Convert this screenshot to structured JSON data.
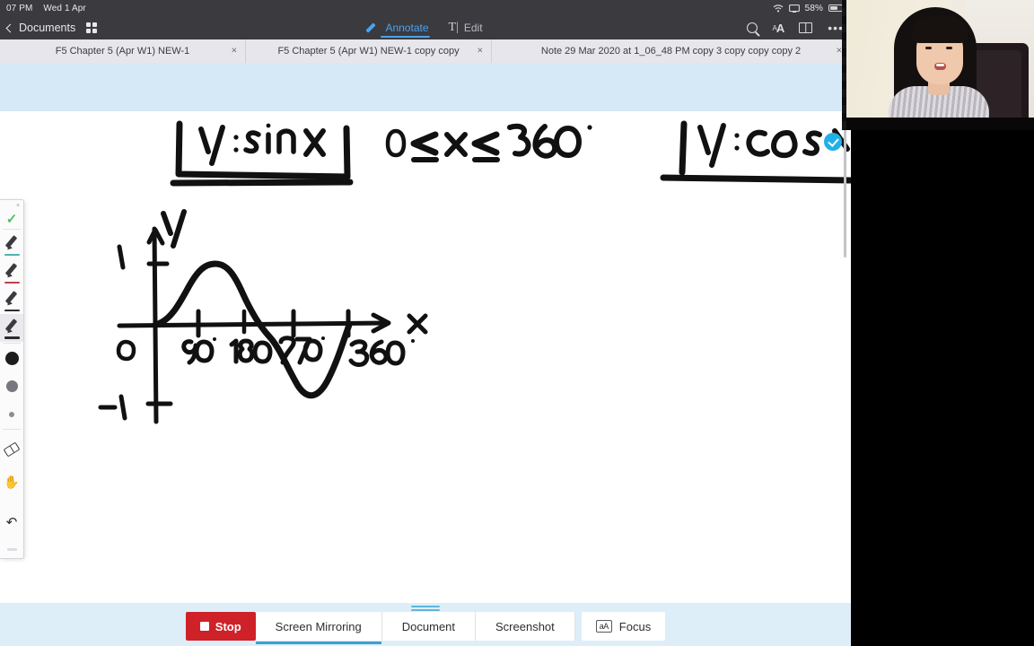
{
  "statusbar": {
    "clock": "07 PM",
    "date": "Wed 1 Apr",
    "battery_percent": "58%",
    "wifi_icon": "wifi-icon",
    "mirroring_icon": "screen-mirroring-icon",
    "battery_icon": "battery-icon"
  },
  "toolbar": {
    "back_label": "Documents",
    "grid_icon": "grid-view-icon",
    "modes": [
      {
        "label": "Annotate",
        "icon": "pen-icon",
        "active": true
      },
      {
        "label": "Edit",
        "icon": "text-cursor-icon",
        "active": false
      }
    ],
    "actions": [
      {
        "name": "search-icon",
        "label": ""
      },
      {
        "name": "text-size-icon",
        "label": "aA"
      },
      {
        "name": "reading-view-icon",
        "label": ""
      },
      {
        "name": "more-options-icon",
        "label": "•••"
      }
    ]
  },
  "tabs": [
    {
      "label": "F5 Chapter 5 (Apr W1) NEW-1",
      "close": "×",
      "active": false
    },
    {
      "label": "F5 Chapter 5 (Apr W1) NEW-1 copy copy",
      "close": "×",
      "active": false
    },
    {
      "label": "Note 29 Mar 2020 at 1_06_48 PM copy 3 copy copy copy 2",
      "close": "×",
      "active": true
    }
  ],
  "palette": {
    "close_label": "×",
    "tools": [
      {
        "name": "confirm-check-tool",
        "kind": "check",
        "color": "#49c45e"
      },
      {
        "name": "pen-tool-teal",
        "kind": "pen",
        "color": "#4fb3ac",
        "selected": false
      },
      {
        "name": "pen-tool-red",
        "kind": "pen",
        "color": "#c0414f",
        "selected": false
      },
      {
        "name": "pen-tool-black",
        "kind": "pen",
        "color": "#2c2c30",
        "selected": false
      },
      {
        "name": "highlighter-tool",
        "kind": "pen",
        "color": "#2c2c30",
        "selected": true
      },
      {
        "name": "stroke-size-large",
        "kind": "dot-lg",
        "color": "#1d1d1f"
      },
      {
        "name": "stroke-size-medium",
        "kind": "dot-md",
        "color": "#77777d"
      },
      {
        "name": "stroke-size-small",
        "kind": "dot-sm",
        "color": "#8d8d93"
      },
      {
        "name": "eraser-tool",
        "kind": "eraser",
        "color": "#3a3a3f"
      },
      {
        "name": "hand-pan-tool",
        "kind": "hand",
        "color": "#2c2c30"
      },
      {
        "name": "undo-button",
        "kind": "undo",
        "color": "#2c2c30"
      }
    ]
  },
  "page": {
    "handwriting": {
      "title_boxed": "y = sin x",
      "domain": "0 ≤ x ≤ 360°",
      "second_title": "y = cos x",
      "axis_y_label": "y",
      "axis_x_label": "x",
      "origin_label": "0",
      "y_max_label": "1",
      "y_min_label": "-1",
      "x_ticks": [
        "90°",
        "180°",
        "270°",
        "360°"
      ]
    },
    "status_badge_icon": "check-circle-icon"
  },
  "chart_data": {
    "type": "line",
    "title": "y = sin x",
    "subtitle": "0 ≤ x ≤ 360°",
    "xlabel": "x",
    "ylabel": "y",
    "xlim": [
      0,
      400
    ],
    "ylim": [
      -1,
      1
    ],
    "x_tick_labels": [
      "0",
      "90°",
      "180°",
      "270°",
      "360°"
    ],
    "x_ticks": [
      0,
      90,
      180,
      270,
      360
    ],
    "y_tick_labels": [
      "1",
      "-1"
    ],
    "y_ticks": [
      1,
      -1
    ],
    "grid": false,
    "legend": "none",
    "series": [
      {
        "name": "sin x",
        "x": [
          0,
          30,
          60,
          90,
          120,
          150,
          180,
          210,
          240,
          270,
          300,
          330,
          360
        ],
        "values": [
          0,
          0.5,
          0.87,
          1,
          0.87,
          0.5,
          0,
          -0.5,
          -0.87,
          -1,
          -0.87,
          -0.5,
          0
        ]
      }
    ]
  },
  "bottombar": {
    "stop_label": "Stop",
    "segments": [
      {
        "label": "Screen Mirroring",
        "active": true
      },
      {
        "label": "Document",
        "active": false
      },
      {
        "label": "Screenshot",
        "active": false
      }
    ],
    "focus_label": "Focus",
    "focus_icon_label": "aA"
  },
  "colors": {
    "accent_blue": "#4aa3ef",
    "stop_red": "#cf2128",
    "bottom_bar_blue": "#ddeef8",
    "band_blue": "#d6e9f6",
    "badge_blue": "#22b0e8"
  }
}
